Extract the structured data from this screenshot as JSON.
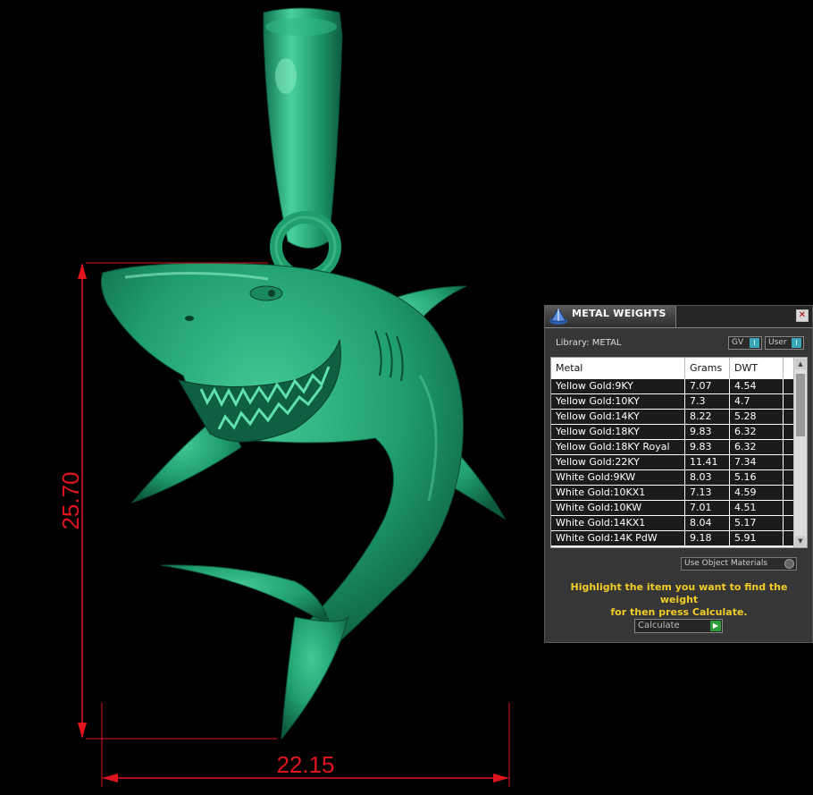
{
  "dimensions": {
    "height_label": "25.70",
    "width_label": "22.15",
    "line_color": "#e0141e"
  },
  "model": {
    "color": "#1f9e6e"
  },
  "panel": {
    "title": "METAL WEIGHTS",
    "close_glyph": "✕",
    "library_label": "Library: METAL",
    "toggle_gv": "GV",
    "toggle_user": "User",
    "toggle_glyph": "I",
    "columns": [
      "Metal",
      "Grams",
      "DWT"
    ],
    "rows": [
      {
        "metal": "Yellow Gold:9KY",
        "grams": "7.07",
        "dwt": "4.54"
      },
      {
        "metal": "Yellow Gold:10KY",
        "grams": "7.3",
        "dwt": "4.7"
      },
      {
        "metal": "Yellow Gold:14KY",
        "grams": "8.22",
        "dwt": "5.28"
      },
      {
        "metal": "Yellow Gold:18KY",
        "grams": "9.83",
        "dwt": "6.32"
      },
      {
        "metal": "Yellow Gold:18KY Royal",
        "grams": "9.83",
        "dwt": "6.32"
      },
      {
        "metal": "Yellow Gold:22KY",
        "grams": "11.41",
        "dwt": "7.34"
      },
      {
        "metal": "White Gold:9KW",
        "grams": "8.03",
        "dwt": "5.16"
      },
      {
        "metal": "White Gold:10KX1",
        "grams": "7.13",
        "dwt": "4.59"
      },
      {
        "metal": "White Gold:10KW",
        "grams": "7.01",
        "dwt": "4.51"
      },
      {
        "metal": "White Gold:14KX1",
        "grams": "8.04",
        "dwt": "5.17"
      },
      {
        "metal": "White Gold:14K PdW",
        "grams": "9.18",
        "dwt": "5.91"
      }
    ],
    "use_object_materials": "Use Object Materials",
    "hint_line1": "Highlight the item you want to find the weight",
    "hint_line2": "for then press Calculate.",
    "calculate_label": "Calculate",
    "calculate_glyph": "▶",
    "accent_color": "#3aa7b8",
    "hint_color": "#f1cd2a"
  }
}
